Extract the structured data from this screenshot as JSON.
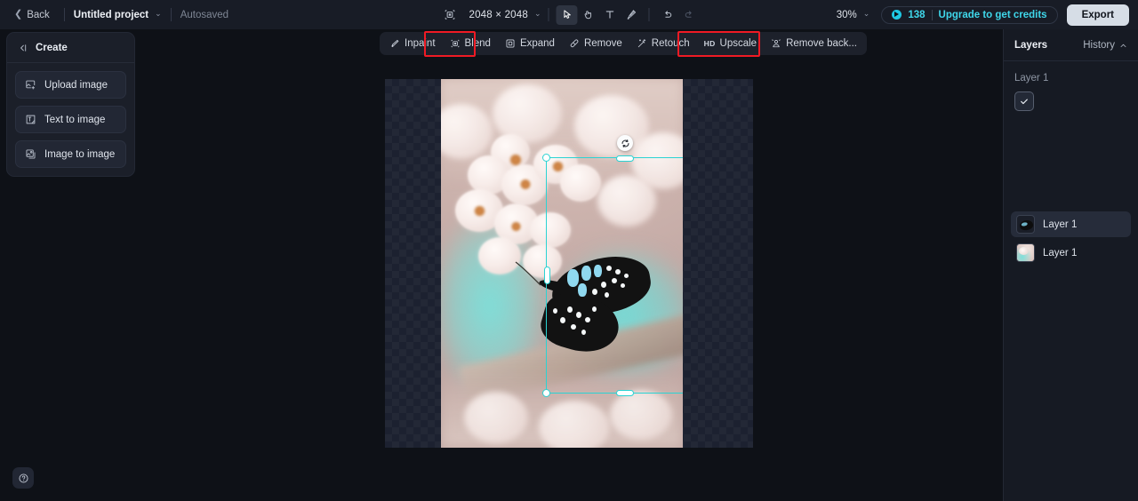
{
  "topbar": {
    "back_label": "Back",
    "project_name": "Untitled project",
    "project_caret": "⌄",
    "autosaved": "Autosaved",
    "crop_icon": "crop-frame-icon",
    "dimensions": "2048 × 2048",
    "dimensions_caret": "⌄",
    "tools": [
      {
        "name": "select-tool",
        "icon": "cursor-arrow-icon",
        "active": true
      },
      {
        "name": "hand-tool",
        "icon": "hand-icon",
        "active": false
      },
      {
        "name": "text-tool",
        "icon": "text-t-icon",
        "active": false
      },
      {
        "name": "brush-tool",
        "icon": "brush-icon",
        "active": false
      }
    ],
    "undo_icon": "undo-arrow-icon",
    "redo_icon": "redo-arrow-icon",
    "zoom_level": "30%",
    "zoom_caret": "⌄",
    "credits_count": "138",
    "upgrade_label": "Upgrade to get credits",
    "export_label": "Export",
    "accent_color": "#3fd7ea"
  },
  "edit_toolbar": {
    "items": [
      {
        "label": "Inpaint",
        "icon": "inpaint-brush-icon",
        "highlighted": false
      },
      {
        "label": "Blend",
        "icon": "blend-layers-icon",
        "highlighted": true
      },
      {
        "label": "Expand",
        "icon": "expand-frame-icon",
        "highlighted": false
      },
      {
        "label": "Remove",
        "icon": "eraser-icon",
        "highlighted": false
      },
      {
        "label": "Retouch",
        "icon": "retouch-wand-icon",
        "highlighted": false
      },
      {
        "label": "Upscale",
        "icon": "hd-badge-icon",
        "highlighted": false,
        "tag": "HD"
      },
      {
        "label": "Remove back...",
        "icon": "remove-background-icon",
        "highlighted": true
      }
    ],
    "highlight_color": "#f01a24"
  },
  "left_panel": {
    "header_title": "Create",
    "collapse_icon": "collapse-panel-icon",
    "items": [
      {
        "label": "Upload image",
        "icon": "upload-image-icon"
      },
      {
        "label": "Text to image",
        "icon": "text-to-image-icon"
      },
      {
        "label": "Image to image",
        "icon": "image-to-image-icon"
      }
    ]
  },
  "help": {
    "icon": "question-mark-icon"
  },
  "canvas": {
    "checkerboard": true,
    "selection": {
      "color": "#2ad3d3",
      "rotate_icon": "rotate-handle-icon",
      "handles": [
        "top-left",
        "top-right",
        "bottom-left",
        "bottom-right",
        "top",
        "bottom",
        "left",
        "right"
      ]
    },
    "image_description": "cherry-blossom-with-butterfly"
  },
  "right_panel": {
    "title": "Layers",
    "history_label": "History",
    "history_caret": "⌃",
    "group_label": "Layer 1",
    "checkbox_icon": "check-icon",
    "layers": [
      {
        "name": "Layer 1",
        "thumbnail": "butterfly-thumbnail",
        "selected": true
      },
      {
        "name": "Layer 1",
        "thumbnail": "blossom-photo-thumbnail",
        "selected": false
      }
    ],
    "annotation_arrow": {
      "icon": "red-down-arrow-annotation",
      "color": "#f01a24"
    }
  }
}
